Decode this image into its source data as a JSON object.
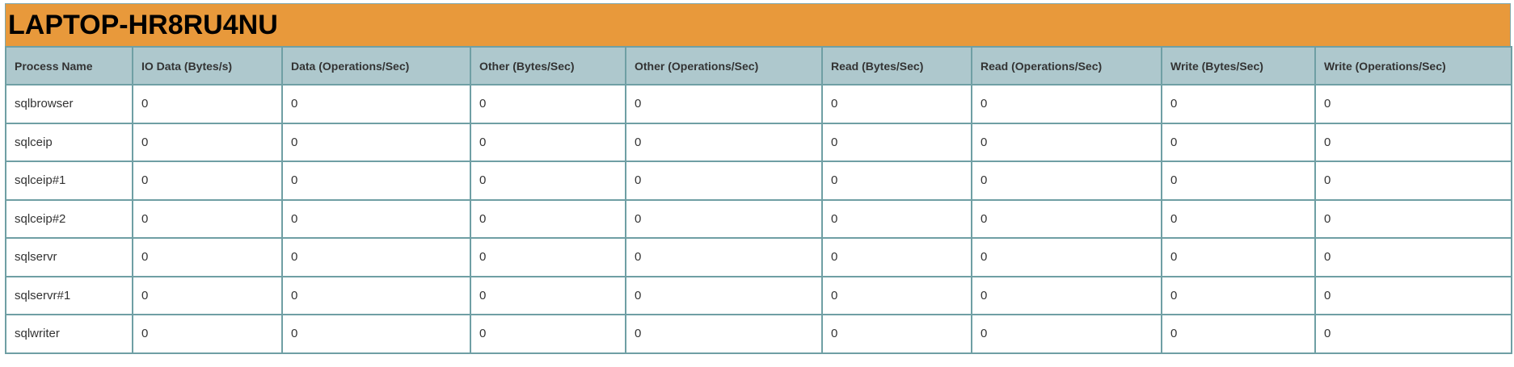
{
  "title": "LAPTOP-HR8RU4NU",
  "columns": [
    "Process Name",
    "IO Data (Bytes/s)",
    "Data (Operations/Sec)",
    "Other (Bytes/Sec)",
    "Other (Operations/Sec)",
    "Read (Bytes/Sec)",
    "Read (Operations/Sec)",
    "Write (Bytes/Sec)",
    "Write (Operations/Sec)"
  ],
  "rows": [
    [
      "sqlbrowser",
      "0",
      "0",
      "0",
      "0",
      "0",
      "0",
      "0",
      "0"
    ],
    [
      "sqlceip",
      "0",
      "0",
      "0",
      "0",
      "0",
      "0",
      "0",
      "0"
    ],
    [
      "sqlceip#1",
      "0",
      "0",
      "0",
      "0",
      "0",
      "0",
      "0",
      "0"
    ],
    [
      "sqlceip#2",
      "0",
      "0",
      "0",
      "0",
      "0",
      "0",
      "0",
      "0"
    ],
    [
      "sqlservr",
      "0",
      "0",
      "0",
      "0",
      "0",
      "0",
      "0",
      "0"
    ],
    [
      "sqlservr#1",
      "0",
      "0",
      "0",
      "0",
      "0",
      "0",
      "0",
      "0"
    ],
    [
      "sqlwriter",
      "0",
      "0",
      "0",
      "0",
      "0",
      "0",
      "0",
      "0"
    ]
  ]
}
